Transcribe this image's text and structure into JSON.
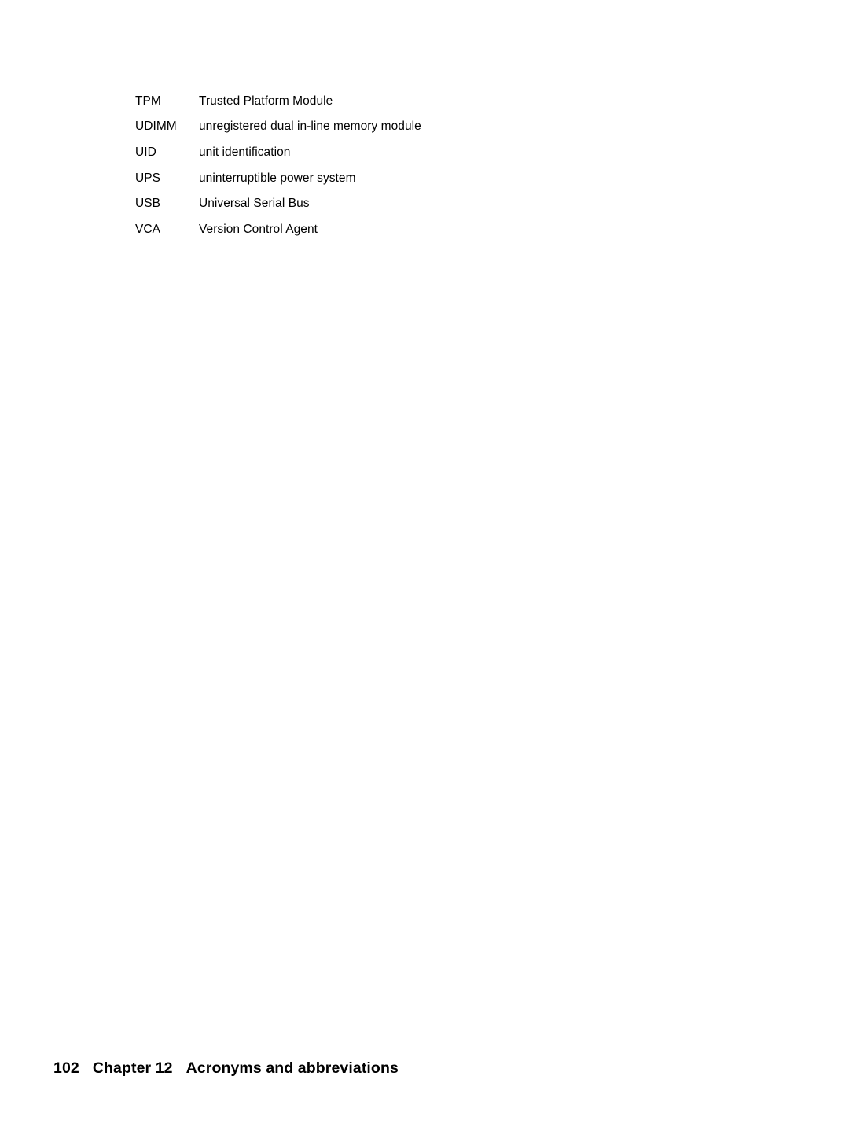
{
  "document": {
    "page_number": "102",
    "chapter_label": "Chapter 12",
    "chapter_title": "Acronyms and abbreviations"
  },
  "glossary": {
    "rows": [
      {
        "term": "TPM",
        "definition": "Trusted Platform Module"
      },
      {
        "term": "UDIMM",
        "definition": "unregistered dual in-line memory module"
      },
      {
        "term": "UID",
        "definition": "unit identification"
      },
      {
        "term": "UPS",
        "definition": "uninterruptible power system"
      },
      {
        "term": "USB",
        "definition": "Universal Serial Bus"
      },
      {
        "term": "VCA",
        "definition": "Version Control Agent"
      }
    ]
  },
  "colors": {
    "page_background": "#ffffff",
    "text": "#000000"
  }
}
